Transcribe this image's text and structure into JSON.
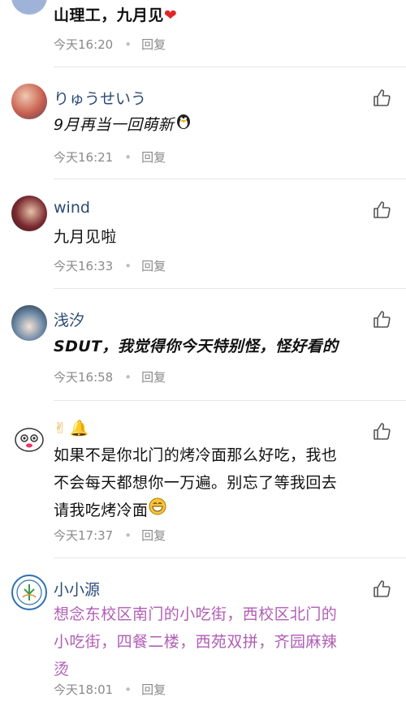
{
  "comments": [
    {
      "name": "",
      "text": "山理工，九月见",
      "time": "今天16:20",
      "reply": "回复"
    },
    {
      "name": "りゅうせいう",
      "text": "9月再当一回萌新",
      "time": "今天16:21",
      "reply": "回复"
    },
    {
      "name": "wind",
      "text": "九月见啦",
      "time": "今天16:33",
      "reply": "回复"
    },
    {
      "name": "浅汐",
      "text": "SDUT，我觉得你今天特别怪，怪好看的",
      "time": "今天16:58",
      "reply": "回复"
    },
    {
      "name": "",
      "text_line1": "如果不是你北门的烤冷面那么好吃，我也",
      "text_line2": "不会每天都想你一万遍。别忘了等我回去",
      "text_line3": "请我吃烤冷面",
      "time": "今天17:37",
      "reply": "回复"
    },
    {
      "name": "小小源",
      "text_line1": "想念东校区南门的小吃街，西校区北门的",
      "text_line2": "小吃街，四餐二楼，西苑双拼，齐园麻辣",
      "text_line3": "烫",
      "time": "今天18:01",
      "reply": "回复"
    }
  ],
  "colors": {
    "name": "#2a4a75",
    "pink_text": "#b15db5",
    "meta": "#8a8a8a"
  },
  "icons": [
    "heart-icon",
    "thumb-up-icon",
    "victory-hand-icon",
    "bell-icon",
    "grin-icon",
    "penguin-icon"
  ]
}
